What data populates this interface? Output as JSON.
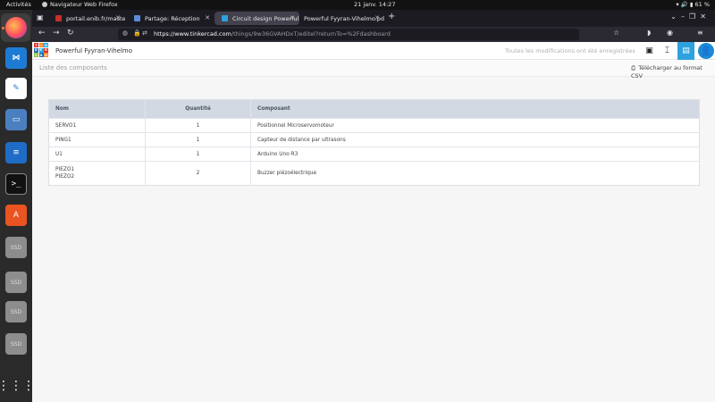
{
  "topbar": {
    "activities": "Activités",
    "app": "Navigateur Web Firefox",
    "clock": "21 janv.  14:27",
    "battery": "61 %"
  },
  "dock": {
    "items": [
      "firefox",
      "vscode",
      "text-editor",
      "files",
      "writer",
      "terminal",
      "software",
      "SSD",
      "SSD",
      "SSD",
      "SSD",
      "apps"
    ]
  },
  "browser": {
    "tabs": [
      {
        "label": "portail.enib.fr/master/dc",
        "favicon_color": "#c4302b"
      },
      {
        "label": "Partage: Réception",
        "favicon_color": "#5a8dd6"
      },
      {
        "label": "Circuit design Powerful F",
        "favicon_color": "#2ea1df"
      },
      {
        "label": "Powerful Fyyran-Vihelmo.pd",
        "favicon_color": "#888888"
      }
    ],
    "url_domain": "https://www.tinkercad.com",
    "url_path": "/things/9w36GVAHDxT/editel?returnTo=%2Fdashboard"
  },
  "tinkercad": {
    "project_name": "Powerful Fyyran-Vihelmo",
    "saved_status": "Toutes les modifications ont été enregistrées",
    "avatar": "👤",
    "logo_letters": [
      "T",
      "I",
      "N",
      "K",
      "E",
      "R",
      "C",
      "A",
      "D"
    ]
  },
  "content": {
    "title": "Liste des composants",
    "csv_label": "Télécharger au format CSV",
    "columns": {
      "name": "Nom",
      "qty": "Quantité",
      "component": "Composant"
    },
    "rows": [
      {
        "names": [
          "SERVO1"
        ],
        "qty": "1",
        "component": "Positionnel Microservomoteur"
      },
      {
        "names": [
          "PING1"
        ],
        "qty": "1",
        "component": "Capteur de distance par ultrasons"
      },
      {
        "names": [
          "U1"
        ],
        "qty": "1",
        "component": "Arduino Uno R3"
      },
      {
        "names": [
          "PIEZO1",
          "PIEZO2"
        ],
        "qty": "2",
        "component": "Buzzer piézoélectrique"
      }
    ]
  },
  "colors": {
    "accent": "#2ea1df",
    "table_header": "#d3d9e2"
  }
}
